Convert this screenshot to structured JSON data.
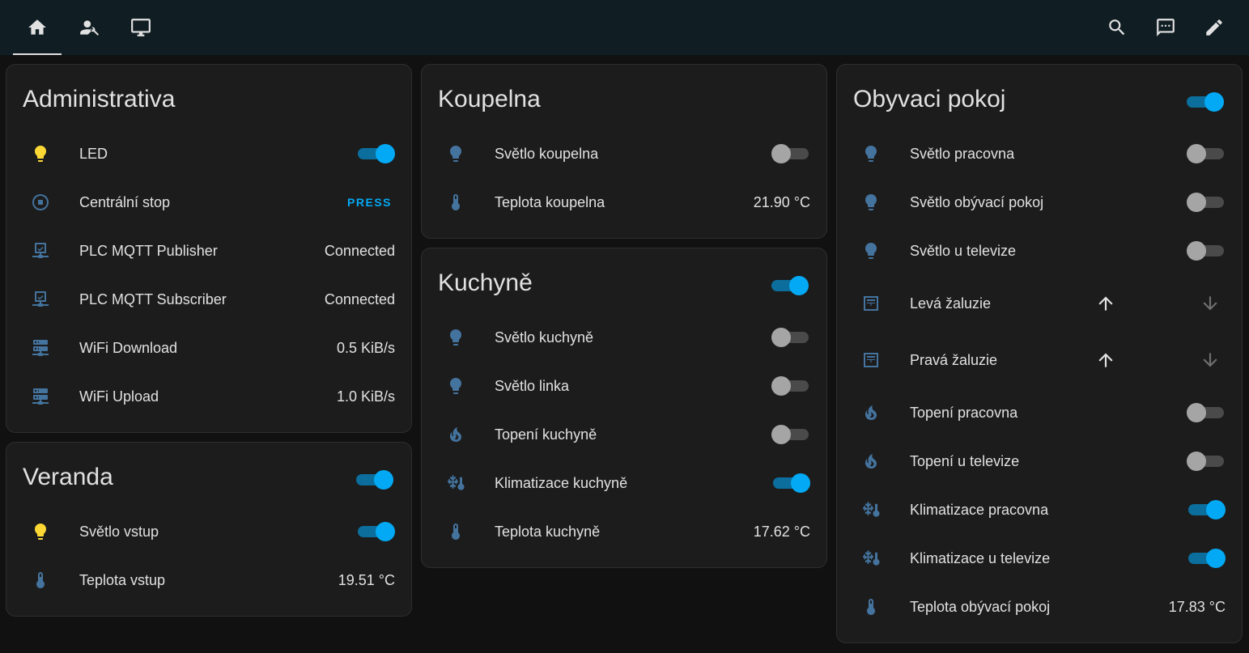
{
  "colors": {
    "accent": "#03a9f4",
    "icon_blue": "#44739e",
    "icon_yellow": "#fdd835",
    "topbar": "#101e24",
    "card": "#1c1c1c"
  },
  "topbar": {
    "tabs": [
      {
        "icon": "home-icon"
      },
      {
        "icon": "account-wrench-icon"
      },
      {
        "icon": "monitor-icon"
      }
    ],
    "actions": [
      {
        "icon": "search-icon"
      },
      {
        "icon": "assist-message-icon"
      },
      {
        "icon": "pencil-icon"
      }
    ]
  },
  "administrativa": {
    "title": "Administrativa",
    "rows": [
      {
        "label": "LED",
        "icon": "lightbulb-icon",
        "state": "on"
      },
      {
        "label": "Centrální stop",
        "icon": "stop-circle-icon",
        "action": "PRESS"
      },
      {
        "label": "PLC MQTT Publisher",
        "icon": "monitor-network-icon",
        "value": "Connected"
      },
      {
        "label": "PLC MQTT Subscriber",
        "icon": "monitor-network-icon",
        "value": "Connected"
      },
      {
        "label": "WiFi Download",
        "icon": "server-network-icon",
        "value": "0.5 KiB/s"
      },
      {
        "label": "WiFi Upload",
        "icon": "server-network-icon",
        "value": "1.0 KiB/s"
      }
    ]
  },
  "veranda": {
    "title": "Veranda",
    "header_toggle": "on",
    "rows": [
      {
        "label": "Světlo vstup",
        "icon": "lightbulb-icon",
        "state": "on"
      },
      {
        "label": "Teplota vstup",
        "icon": "thermometer-icon",
        "value": "19.51 °C"
      }
    ]
  },
  "koupelna": {
    "title": "Koupelna",
    "rows": [
      {
        "label": "Světlo koupelna",
        "icon": "lightbulb-icon",
        "state": "off"
      },
      {
        "label": "Teplota koupelna",
        "icon": "thermometer-icon",
        "value": "21.90 °C"
      }
    ]
  },
  "kuchyne": {
    "title": "Kuchyně",
    "header_toggle": "on",
    "rows": [
      {
        "label": "Světlo kuchyně",
        "icon": "lightbulb-icon",
        "state": "off"
      },
      {
        "label": "Světlo linka",
        "icon": "lightbulb-icon",
        "state": "off"
      },
      {
        "label": "Topení kuchyně",
        "icon": "fire-icon",
        "state": "off"
      },
      {
        "label": "Klimatizace kuchyně",
        "icon": "snowflake-thermometer-icon",
        "state": "on"
      },
      {
        "label": "Teplota kuchyně",
        "icon": "thermometer-icon",
        "value": "17.62 °C"
      }
    ]
  },
  "obyvaci": {
    "title": "Obyvaci pokoj",
    "header_toggle": "on",
    "rows": [
      {
        "label": "Světlo pracovna",
        "icon": "lightbulb-icon",
        "state": "off"
      },
      {
        "label": "Světlo obývací pokoj",
        "icon": "lightbulb-icon",
        "state": "off"
      },
      {
        "label": "Světlo u televize",
        "icon": "lightbulb-icon",
        "state": "off"
      },
      {
        "label": "Levá žaluzie",
        "icon": "window-shutter-icon"
      },
      {
        "label": "Pravá žaluzie",
        "icon": "window-shutter-icon"
      },
      {
        "label": "Topení pracovna",
        "icon": "fire-icon",
        "state": "off"
      },
      {
        "label": "Topení u televize",
        "icon": "fire-icon",
        "state": "off"
      },
      {
        "label": "Klimatizace pracovna",
        "icon": "snowflake-thermometer-icon",
        "state": "on"
      },
      {
        "label": "Klimatizace u televize",
        "icon": "snowflake-thermometer-icon",
        "state": "on"
      },
      {
        "label": "Teplota obývací pokoj",
        "icon": "thermometer-icon",
        "value": "17.83 °C"
      }
    ]
  }
}
